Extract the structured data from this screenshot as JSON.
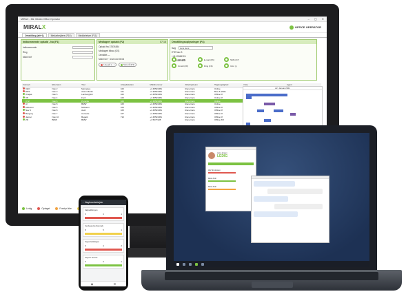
{
  "desktop": {
    "window_title": "MIRAX - Mir. Miralix Office Operator",
    "window_controls": [
      "–",
      "▢",
      "✕"
    ],
    "brand_main": "MIRAL",
    "brand_x": "X",
    "partner_name": "OFFICE OPERATOR",
    "tabs": [
      "Omstilling (alt+1)",
      "Medarbejdere (F10)",
      "Meddelelser (F11)"
    ],
    "panels": {
      "search": {
        "title": "Indkommende opkald - Nu (F1)",
        "fields": [
          "Indkommende",
          "Ring",
          "Mobil forf"
        ]
      },
      "call": {
        "title": "Medlagert opkald (F2)",
        "aux": "07:16",
        "lines": [
          "Opkald fra 37874884",
          "Medlagert tilbao (OS)",
          "Omstillet —",
          "Mobil forf · reserved 06:04"
        ],
        "actions": [
          "Læg på (→)",
          "Sæt på (F3)"
        ]
      },
      "contact": {
        "title": "Omstillingsoplysninger (F4)",
        "search_label": "Søg",
        "search_value": "Jens Jens",
        "lines": [
          "ETE Nav 3",
          "+46 15345124",
          "+4570879990"
        ],
        "quick": [
          "Info (F5)",
          "E-mail (F6)",
          "SMS (F7)",
          "Omstil (F8)",
          "Ring (F9)",
          "Infor (-)"
        ]
      }
    },
    "table": {
      "headers": [
        "Fornavn",
        "Efternavn",
        "Titel",
        "Arbejdsstation",
        "Mobilnummer",
        "Afdeling/team",
        "Tilgængelighed",
        "Note",
        "Agent"
      ],
      "rows": [
        [
          "CEO",
          "Nav 2",
          "Mercedes",
          "100",
          "+4 45523451",
          "Race Cars",
          "Online",
          "Interval 4x indsigts",
          "Pause"
        ],
        [
          "DDS",
          "Nav 3",
          "Aston Martin",
          "101",
          "+4 45523451",
          "Race Cars",
          "Bew & aftale",
          "12 pauser : 08:57",
          "Pause"
        ],
        [
          "Ovejas",
          "Nav 5",
          "Lamborghini",
          "102",
          "+4 45523451",
          "Race Cars",
          "Offline tlf",
          "",
          "Ikke logget ind"
        ],
        [
          "VP",
          "Nav 4",
          "Ford",
          "103",
          "+4 45523451",
          "Race Cars",
          "Online tlf",
          "",
          "Ikke logget ind"
        ],
        [
          "XYZ",
          "Nav 6",
          "Porsche",
          "106",
          "+4 45523451",
          "Race Cars",
          "Online",
          "",
          "Pause"
        ],
        [
          "Al",
          "Nav 8",
          "BMW",
          "105",
          "+4 45523451",
          "Race Cars",
          "Online",
          "",
          "Optaget"
        ],
        [
          "McLaren",
          "Nav 5",
          "McLaren",
          "104",
          "+4 45523451",
          "Race Cars",
          "Offline tlf",
          "Optaget • 19:36",
          "Ikke logget ind"
        ],
        [
          "Nav 4",
          "Nav 8",
          "Audi",
          "105",
          "+4 45523451",
          "Race Cars",
          "Offline tlf",
          "",
          "Ikke logget ind"
        ],
        [
          "Bergerg",
          "Nav 7",
          "Corvette",
          "107",
          "+4 45523451",
          "Race Cars",
          "Offline tlf",
          "",
          "Ikke logget ind"
        ],
        [
          "Jayner",
          "Nav 10",
          "Bugatti",
          "710",
          "+4 45523451",
          "Race Cars",
          "Offline tlf",
          "",
          "Ikke logget ind"
        ],
        [
          "ZR",
          "BMW",
          "BMW",
          "",
          "+4 5077328",
          "Race Cars",
          "Offline ZIX",
          "",
          "Ikke logget ind"
        ]
      ],
      "status_colors": [
        "#e0574f",
        "#e0574f",
        "#7cc242",
        "#7cc242",
        "#7cc242",
        "#e0574f",
        "#e0574f",
        "#7cc242",
        "#e0574f",
        "#e0574f",
        "#7cc242"
      ],
      "selected_row": 4
    },
    "gantt_date": "22. Januar 2021",
    "legend": [
      {
        "label": "Ledig",
        "color": "#7cc242"
      },
      {
        "label": "Optaget",
        "color": "#e0574f"
      },
      {
        "label": "Forstyr ikke",
        "color": "#f2a341"
      },
      {
        "label": "Vente",
        "color": "#f1d14b"
      }
    ]
  },
  "laptop": {
    "card_name": "Jens Jensen",
    "card_status": "LEDIG",
    "card_rows": [
      "Ally Bo Hansen",
      "Mette Bull",
      "Mette Bull"
    ]
  },
  "phone": {
    "header_title": "Nøglemedarbejder",
    "cards": [
      {
        "title": "Salgsafdelingen",
        "values": [
          "5",
          "3",
          "1"
        ],
        "strip": "#e0574f"
      },
      {
        "title": "Kundeservice Danmark",
        "values": [
          "8",
          "5",
          "1"
        ],
        "strip": "#f1d14b"
      },
      {
        "title": "Supportafdelingen",
        "values": [
          "9",
          "4",
          "2"
        ],
        "strip": "#e0574f"
      },
      {
        "title": "Support Service",
        "values": [
          "6",
          "3",
          "1"
        ],
        "strip": "#7cc242"
      }
    ],
    "nav": [
      "◉",
      "☰"
    ]
  },
  "colors": {
    "accent_green": "#7cc242",
    "busy_red": "#e0574f",
    "away_orange": "#f2a341",
    "purple_block": "#7a5aa8",
    "blue_block": "#4a6cc9"
  }
}
